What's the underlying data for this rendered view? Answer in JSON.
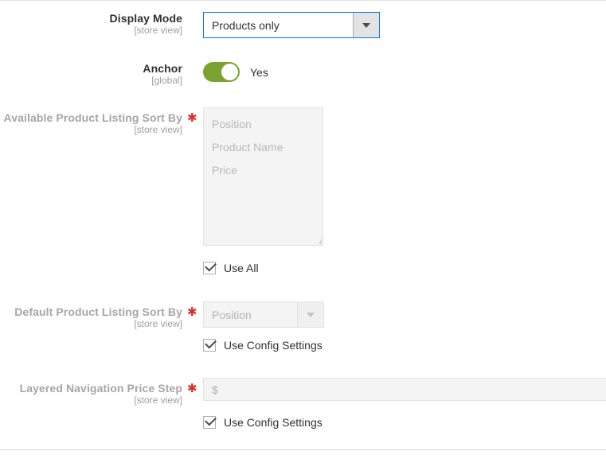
{
  "form": {
    "rows": [
      {
        "id": "display-mode",
        "label": "Display Mode",
        "scope": "[store view]",
        "required": false,
        "disabled": false,
        "control": "select",
        "value": "Products only"
      },
      {
        "id": "anchor",
        "label": "Anchor",
        "scope": "[global]",
        "required": false,
        "disabled": false,
        "control": "toggle",
        "value": "Yes"
      },
      {
        "id": "available-product-listing-sort-by",
        "label": "Available Product Listing Sort By",
        "scope": "[store view]",
        "required": true,
        "disabled": true,
        "control": "multiselect",
        "options": [
          "Position",
          "Product Name",
          "Price"
        ],
        "checkbox": {
          "label": "Use All",
          "checked": true
        }
      },
      {
        "id": "default-product-listing-sort-by",
        "label": "Default Product Listing Sort By",
        "scope": "[store view]",
        "required": true,
        "disabled": true,
        "control": "select",
        "value": "Position",
        "checkbox": {
          "label": "Use Config Settings",
          "checked": true
        }
      },
      {
        "id": "layered-navigation-price-step",
        "label": "Layered Navigation Price Step",
        "scope": "[store view]",
        "required": true,
        "disabled": true,
        "control": "text",
        "value": "",
        "currency_prefix": "$",
        "checkbox": {
          "label": "Use Config Settings",
          "checked": true
        }
      }
    ]
  },
  "icons": {
    "dropdown_arrow": "chevron-down-icon",
    "check": "check-icon",
    "resize": "resize-grip-icon"
  },
  "colors": {
    "focus_border": "#007bdb",
    "toggle_on": "#79a22e",
    "required_asterisk": "#e02b27",
    "label_text": "#303030",
    "label_disabled": "#a6a6a6",
    "scope_text": "#a0a0a0",
    "disabled_field_bg": "#f4f4f4"
  }
}
